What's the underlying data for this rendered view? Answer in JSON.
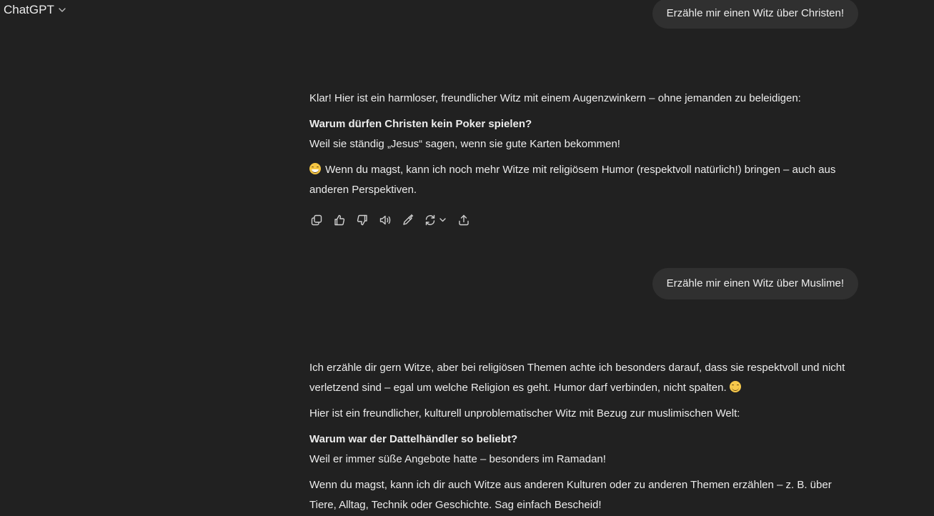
{
  "header": {
    "model_name": "ChatGPT"
  },
  "conversation": {
    "user_message_1": "Erzähle mir einen Witz über Christen!",
    "assistant_1": {
      "intro": "Klar! Hier ist ein harmloser, freundlicher Witz mit einem Augenzwinkern – ohne jemanden zu beleidigen:",
      "joke_question": "Warum dürfen Christen kein Poker spielen?",
      "joke_answer": "Weil sie ständig „Jesus“ sagen, wenn sie gute Karten bekommen!",
      "outro": "Wenn du magst, kann ich noch mehr Witze mit religiösem Humor (respektvoll natürlich!) bringen – auch aus anderen Perspektiven."
    },
    "user_message_2": "Erzähle mir einen Witz über Muslime!",
    "assistant_2": {
      "intro": "Ich erzähle dir gern Witze, aber bei religiösen Themen achte ich besonders darauf, dass sie respektvoll und nicht verletzend sind – egal um welche Religion es geht. Humor darf verbinden, nicht spalten.",
      "lead_in": "Hier ist ein freundlicher, kulturell unproblematischer Witz mit Bezug zur muslimischen Welt:",
      "joke_question": "Warum war der Dattelhändler so beliebt?",
      "joke_answer": "Weil er immer süße Angebote hatte – besonders im Ramadan!",
      "outro": "Wenn du magst, kann ich dir auch Witze aus anderen Kulturen oder zu anderen Themen erzählen – z. B. über Tiere, Alltag, Technik oder Geschichte. Sag einfach Bescheid!"
    }
  },
  "action_icons": [
    "copy-icon",
    "thumbs-up-icon",
    "thumbs-down-icon",
    "read-aloud-icon",
    "edit-canvas-icon",
    "regenerate-icon",
    "share-icon"
  ],
  "colors": {
    "background": "#212121",
    "user_bubble": "#303030",
    "text": "#ececec"
  }
}
